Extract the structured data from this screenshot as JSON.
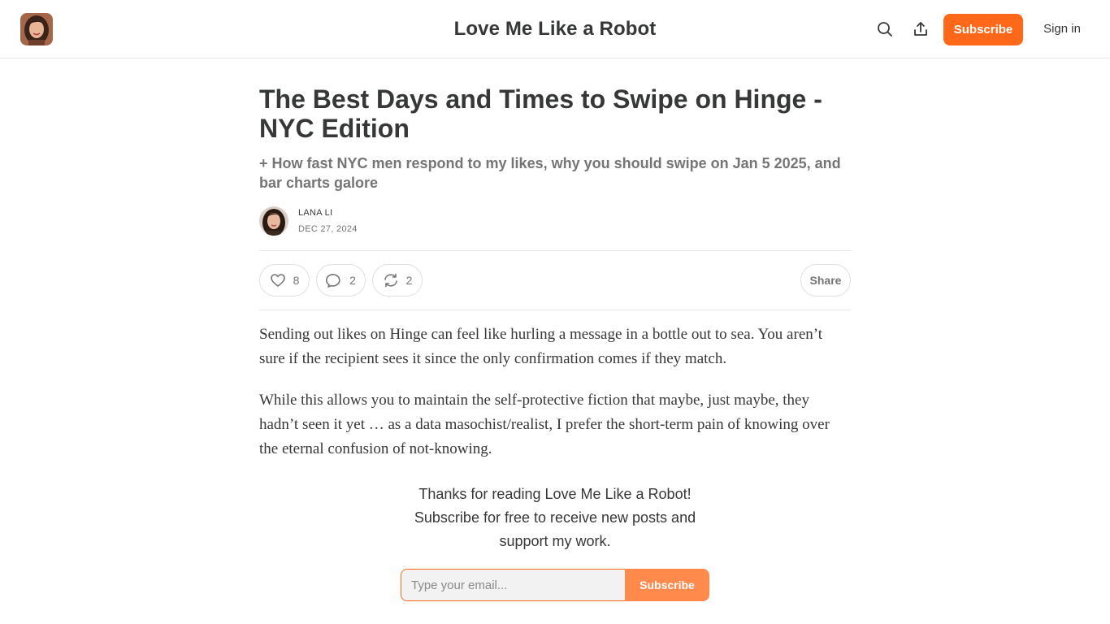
{
  "header": {
    "publication_title": "Love Me Like a Robot",
    "subscribe_label": "Subscribe",
    "signin_label": "Sign in",
    "icons": {
      "search": "search-icon",
      "share": "share-icon"
    }
  },
  "post": {
    "title": "The Best Days and Times to Swipe on Hinge - NYC Edition",
    "subtitle": "+ How fast NYC men respond to my likes, why you should swipe on Jan 5 2025, and bar charts galore",
    "author": "LANA LI",
    "date": "DEC 27, 2024",
    "actions": {
      "likes": "8",
      "comments": "2",
      "restacks": "2",
      "share_label": "Share"
    },
    "paragraphs": [
      "Sending out likes on Hinge can feel like hurling a message in a bottle out to sea. You aren’t sure if the recipient sees it since the only confirmation comes if they match.",
      "While this allows you to maintain the self-protective fiction that maybe, just maybe, they hadn’t seen it yet … as a data masochist/realist, I prefer the short-term pain of knowing over the eternal confusion of not-knowing."
    ]
  },
  "subscribe_widget": {
    "lines": [
      "Thanks for reading Love Me Like a Robot!",
      "Subscribe for free to receive new posts and",
      "support my work."
    ],
    "email_placeholder": "Type your email...",
    "button_label": "Subscribe"
  },
  "colors": {
    "accent": "#ff6719",
    "accent_light": "#ff8a4c",
    "text": "#363737",
    "muted": "#757575",
    "divider": "#e6e6e6"
  }
}
